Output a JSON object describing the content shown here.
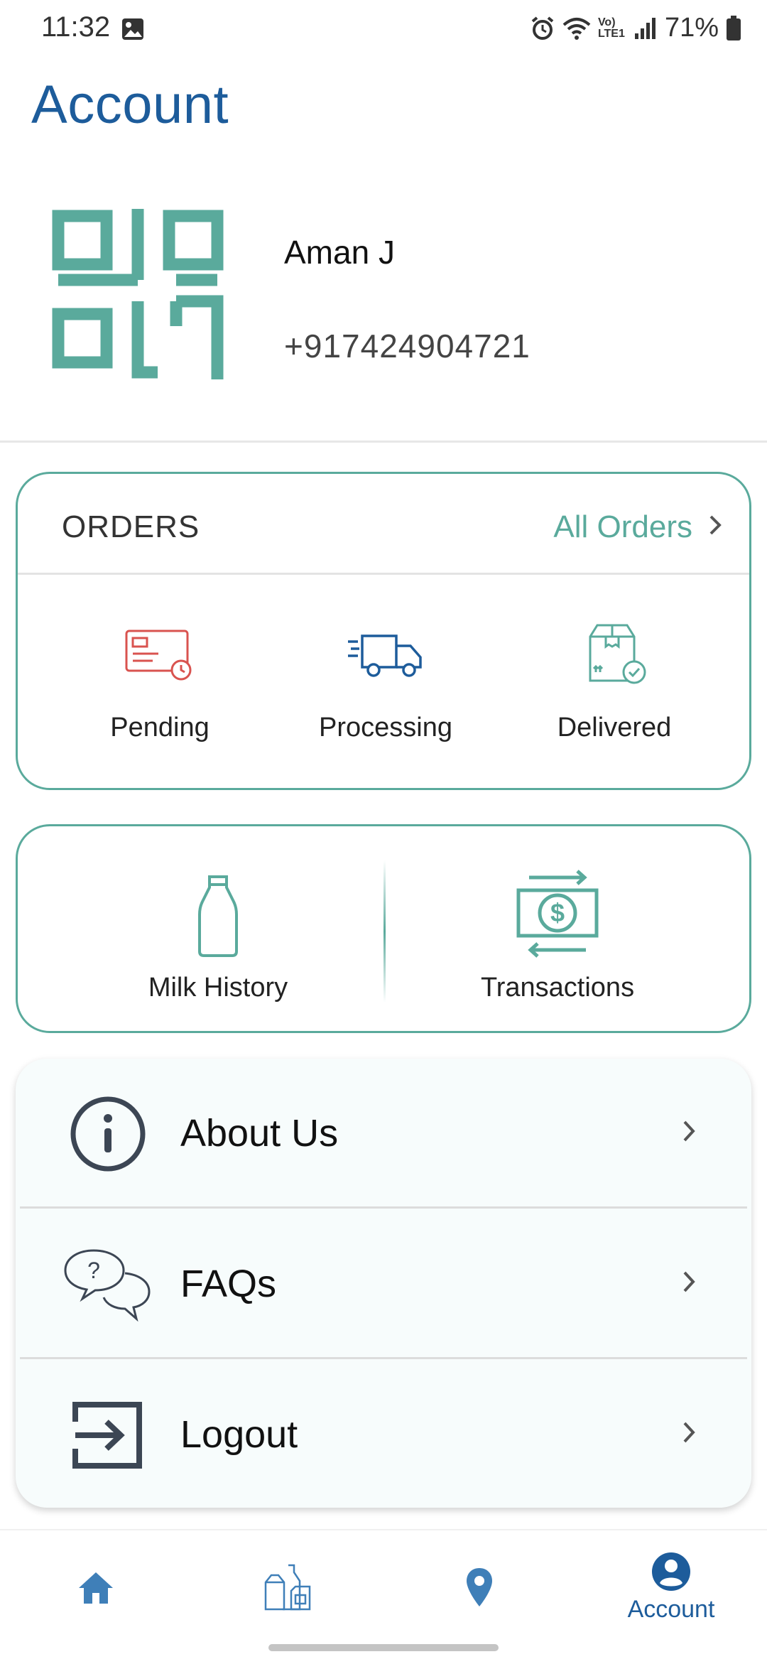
{
  "status_bar": {
    "time": "11:32",
    "battery": "71%",
    "network": "Vo) LTE1"
  },
  "header": {
    "title": "Account"
  },
  "profile": {
    "name": "Aman J",
    "phone": "+917424904721"
  },
  "orders": {
    "title": "ORDERS",
    "all_orders_label": "All Orders",
    "statuses": [
      {
        "label": "Pending",
        "icon": "card-clock-icon",
        "color": "#d9534f"
      },
      {
        "label": "Processing",
        "icon": "delivery-truck-icon",
        "color": "#1d5c9b"
      },
      {
        "label": "Delivered",
        "icon": "package-check-icon",
        "color": "#5aaa9c"
      }
    ]
  },
  "quick_links": [
    {
      "label": "Milk History",
      "icon": "milk-bottle-icon"
    },
    {
      "label": "Transactions",
      "icon": "money-transfer-icon"
    }
  ],
  "menu": [
    {
      "label": "About Us",
      "icon": "info-icon"
    },
    {
      "label": "FAQs",
      "icon": "faq-chat-icon"
    },
    {
      "label": "Logout",
      "icon": "logout-icon"
    }
  ],
  "bottom_nav": [
    {
      "icon": "home-icon",
      "label": "",
      "active": false
    },
    {
      "icon": "milk-products-icon",
      "label": "",
      "active": false
    },
    {
      "icon": "location-pin-icon",
      "label": "",
      "active": false
    },
    {
      "icon": "account-icon",
      "label": "Account",
      "active": true
    }
  ],
  "colors": {
    "primary": "#1d5c9b",
    "accent": "#5aaa9c",
    "pending": "#d9534f",
    "card_bg": "#f7fcfc"
  }
}
